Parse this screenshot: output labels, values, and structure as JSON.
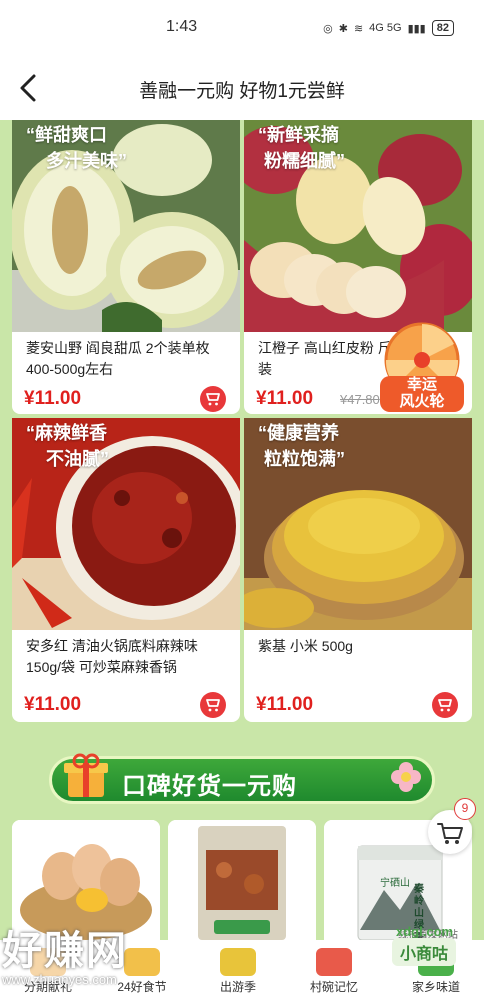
{
  "status_bar": {
    "time": "1:43",
    "network": "4G 5G",
    "battery": "82"
  },
  "header": {
    "title": "善融一元购 好物1元尝鲜"
  },
  "products": [
    {
      "tag_line1": "“鲜甜爽口",
      "tag_line2": "多汁美味”",
      "name": "菱安山野 阎良甜瓜 2个装单枚400-500g左右",
      "price": "¥11.00",
      "orig_price": ""
    },
    {
      "tag_line1": "“新鲜采摘",
      "tag_line2": "粉糯细腻”",
      "name": "江橙子 高山红皮粉 斤装",
      "price": "¥11.00",
      "orig_price": "¥47.80"
    },
    {
      "tag_line1": "“麻辣鲜香",
      "tag_line2": "不油腻”",
      "name": "安多红 清油火锅底料麻辣味150g/袋 可炒菜麻辣香锅",
      "price": "¥11.00",
      "orig_price": ""
    },
    {
      "tag_line1": "“健康营养",
      "tag_line2": "粒粒饱满”",
      "name": "紫基 小米 500g",
      "price": "¥11.00",
      "orig_price": ""
    }
  ],
  "lucky_wheel": {
    "line1": "幸运",
    "line2": "风火轮"
  },
  "promo_banner": {
    "text": "口碑好货一元购"
  },
  "cart": {
    "count": "9"
  },
  "bottom_strip": {
    "tea_brand": "秦岭山绿茶",
    "tea_top": "宁硒山",
    "watermark_site": "xdgl.com",
    "watermark_tip": "线报首发网站"
  },
  "watermark": {
    "big": "好赚网",
    "url": "www.zhuanyes.com"
  },
  "watermark2": "小商咕",
  "nav": [
    {
      "label": "分期献礼"
    },
    {
      "label": "24好食节"
    },
    {
      "label": "出游季"
    },
    {
      "label": "村碗记忆"
    },
    {
      "label": "家乡味道"
    }
  ]
}
